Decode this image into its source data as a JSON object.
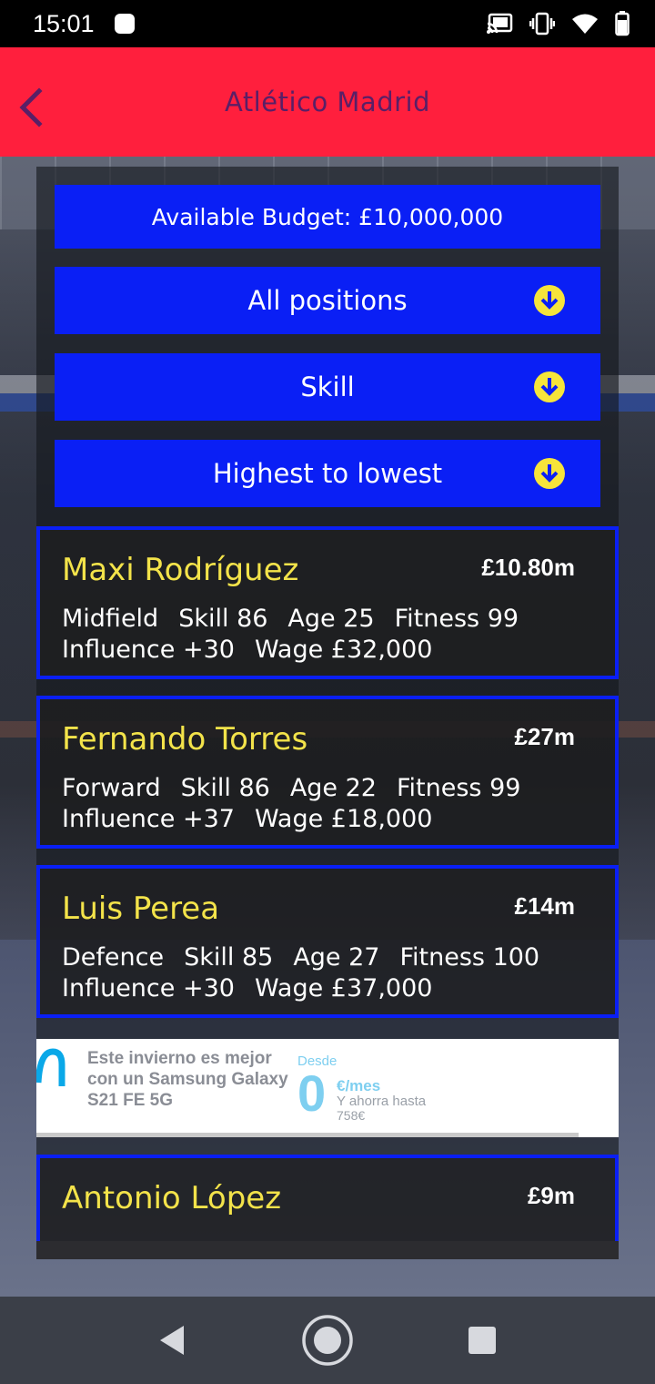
{
  "status_bar": {
    "time": "15:01",
    "icons": [
      "notification-icon",
      "cast-icon",
      "vibrate-icon",
      "wifi-icon",
      "battery-icon"
    ]
  },
  "header": {
    "title": "Atlético Madrid",
    "back_icon": "chevron-left-icon"
  },
  "budget": {
    "label": "Available Budget: £10,000,000"
  },
  "filters": [
    {
      "label": "All positions",
      "icon": "arrow-down-circle-icon"
    },
    {
      "label": "Skill",
      "icon": "arrow-down-circle-icon"
    },
    {
      "label": "Highest to lowest",
      "icon": "arrow-down-circle-icon"
    }
  ],
  "players": [
    {
      "name": "Maxi Rodríguez",
      "price": "£10.80m",
      "position": "Midfield",
      "skill": "Skill 86",
      "age": "Age 25",
      "fitness": "Fitness 99",
      "influence": "Influence +30",
      "wage": "Wage £32,000"
    },
    {
      "name": "Fernando Torres",
      "price": "£27m",
      "position": "Forward",
      "skill": "Skill 86",
      "age": "Age 22",
      "fitness": "Fitness 99",
      "influence": "Influence +37",
      "wage": "Wage £18,000"
    },
    {
      "name": "Luis Perea",
      "price": "£14m",
      "position": "Defence",
      "skill": "Skill 85",
      "age": "Age 27",
      "fitness": "Fitness 100",
      "influence": "Influence +30",
      "wage": "Wage £37,000"
    },
    {
      "name": "Antonio López",
      "price": "£9m"
    }
  ],
  "ad": {
    "headline": "Este invierno es mejor con un Samsung Galaxy S21 FE 5G",
    "desde": "Desde",
    "price_big": "0",
    "per_month": "€/mes",
    "save_text": "Y ahorra hasta",
    "save_amount": "758€"
  },
  "colors": {
    "header_bg": "#ff1f3d",
    "header_title": "#5a1f66",
    "button_blue": "#0a1ff5",
    "player_name": "#f3e34a",
    "arrow_yellow": "#f6e43a"
  },
  "nav": {
    "back_icon": "back-triangle-icon",
    "home_icon": "home-circle-icon",
    "recents_icon": "recents-square-icon"
  }
}
